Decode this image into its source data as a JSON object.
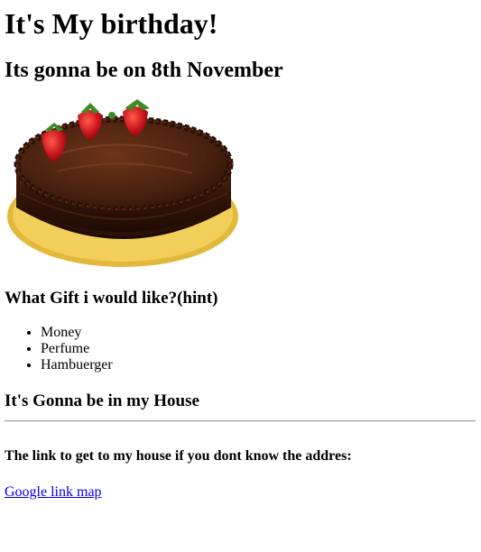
{
  "page": {
    "title": "It's My birthday!",
    "subtitle": "Its gonna be on 8th November",
    "cake_image": "chocolate-cake-with-strawberries",
    "gift_heading": "What Gift i would like?(hint)",
    "gifts": [
      "Money",
      "Perfume",
      "Hambuerger"
    ],
    "place_heading": "It's Gonna be in my House",
    "link_intro": "The link to get to my house if you dont know the addres:",
    "map_link_text": "Google link map"
  },
  "colors": {
    "link": "#0000ee",
    "cake_chocolate": "#3a1a0c",
    "cake_board": "#e2b93b",
    "strawberry": "#c8141c"
  }
}
